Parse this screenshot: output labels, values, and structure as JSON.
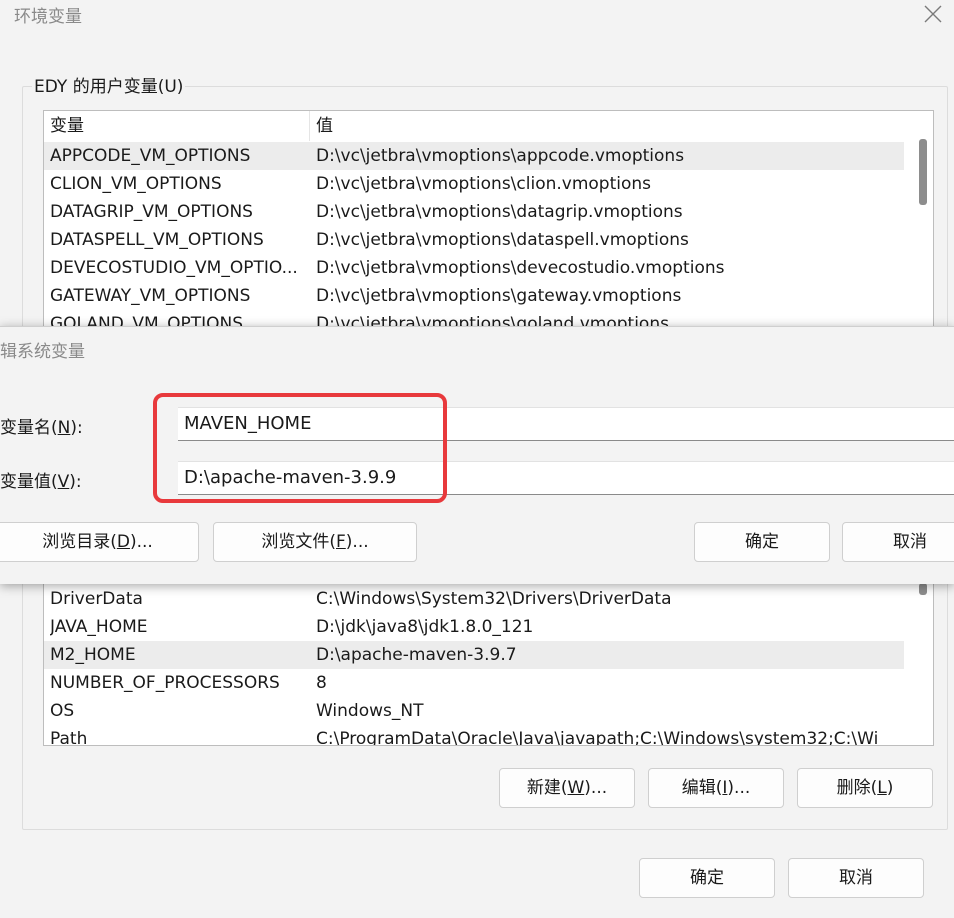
{
  "env_window": {
    "title": "环境变量",
    "user_group_label": "EDY 的用户变量(U)",
    "columns": [
      "变量",
      "值"
    ],
    "user_vars": [
      {
        "name": "APPCODE_VM_OPTIONS",
        "value": "D:\\vc\\jetbra\\vmoptions\\appcode.vmoptions"
      },
      {
        "name": "CLION_VM_OPTIONS",
        "value": "D:\\vc\\jetbra\\vmoptions\\clion.vmoptions"
      },
      {
        "name": "DATAGRIP_VM_OPTIONS",
        "value": "D:\\vc\\jetbra\\vmoptions\\datagrip.vmoptions"
      },
      {
        "name": "DATASPELL_VM_OPTIONS",
        "value": "D:\\vc\\jetbra\\vmoptions\\dataspell.vmoptions"
      },
      {
        "name": "DEVECOSTUDIO_VM_OPTIO...",
        "value": "D:\\vc\\jetbra\\vmoptions\\devecostudio.vmoptions"
      },
      {
        "name": "GATEWAY_VM_OPTIONS",
        "value": "D:\\vc\\jetbra\\vmoptions\\gateway.vmoptions"
      },
      {
        "name": "GOLAND_VM_OPTIONS",
        "value": "D:\\vc\\jetbra\\vmoptions\\goland.vmoptions"
      }
    ],
    "system_vars": [
      {
        "name": "DriverData",
        "value": "C:\\Windows\\System32\\Drivers\\DriverData"
      },
      {
        "name": "JAVA_HOME",
        "value": "D:\\jdk\\java8\\jdk1.8.0_121"
      },
      {
        "name": "M2_HOME",
        "value": "D:\\apache-maven-3.9.7"
      },
      {
        "name": "NUMBER_OF_PROCESSORS",
        "value": "8"
      },
      {
        "name": "OS",
        "value": "Windows_NT"
      },
      {
        "name": "Path",
        "value": "C:\\ProgramData\\Oracle\\Java\\javapath;C:\\Windows\\system32;C:\\Wi"
      }
    ],
    "sys_buttons": {
      "new_pre": "新建(",
      "new_key": "W",
      "new_post": ")...",
      "edit_pre": "编辑(",
      "edit_key": "I",
      "edit_post": ")...",
      "delete_pre": "删除(",
      "delete_key": "L",
      "delete_post": ")"
    },
    "ok_label": "确定",
    "cancel_label": "取消"
  },
  "edit_dialog": {
    "title": "辑系统变量",
    "name_label_pre": "变量名(",
    "name_label_key": "N",
    "name_label_post": "):",
    "value_label_pre": "变量值(",
    "value_label_key": "V",
    "value_label_post": "):",
    "name_value": "MAVEN_HOME",
    "value_value": "D:\\apache-maven-3.9.9",
    "browse_dir_pre": "浏览目录(",
    "browse_dir_key": "D",
    "browse_dir_post": ")...",
    "browse_file_pre": "浏览文件(",
    "browse_file_key": "F",
    "browse_file_post": ")...",
    "ok_label": "确定",
    "cancel_label": "取消"
  },
  "colors": {
    "highlight": "#e8393c",
    "selected_row": "#ececec"
  }
}
